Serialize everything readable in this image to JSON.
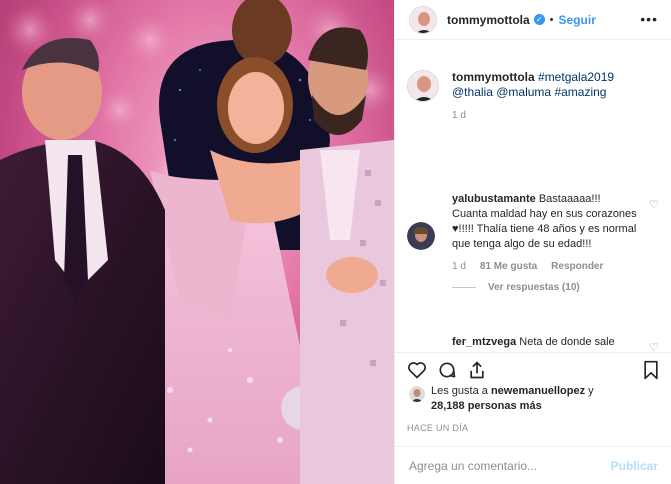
{
  "post": {
    "username": "tommymottola",
    "verified_mark": "✓",
    "separator": "•",
    "follow_label": "Seguir",
    "more_label": "•••"
  },
  "caption": {
    "username": "tommymottola",
    "hashtag_metgala": "#metgala2019",
    "mention_thalia": "@thalia",
    "mention_maluma": "@maluma",
    "hashtag_amazing": "#amazing",
    "time": "1 d"
  },
  "comments": [
    {
      "username": "yalubustamante",
      "text": "Bastaaaaa!!! Cuanta maldad hay en sus corazones ♥!!!!! Thalía tiene 48 años y es normal que tenga algo de su edad!!!",
      "time": "1 d",
      "likes": "81 Me gusta",
      "reply_label": "Responder",
      "view_replies": "Ver respuestas (10)"
    },
    {
      "username": "fer_mtzvega",
      "text": "Neta de donde sale tanta vieja envidiosa seguro esas ni siquiera tienen un marido que las aguante aparte de feas"
    }
  ],
  "likes": {
    "prefix": "Les gusta a",
    "user": "newemanuellopez",
    "connector": "y",
    "count": "28,188 personas más"
  },
  "posted_ago": "HACE UN DÍA",
  "add_comment": {
    "placeholder": "Agrega un comentario...",
    "publish_label": "Publicar"
  },
  "icons": {
    "like": "heart-icon",
    "comment": "comment-icon",
    "share": "share-icon",
    "save": "bookmark-icon"
  },
  "colors": {
    "accent": "#3897f0",
    "link": "#003569",
    "muted": "#8e8e8e",
    "publish_disabled": "#b2dffc"
  }
}
